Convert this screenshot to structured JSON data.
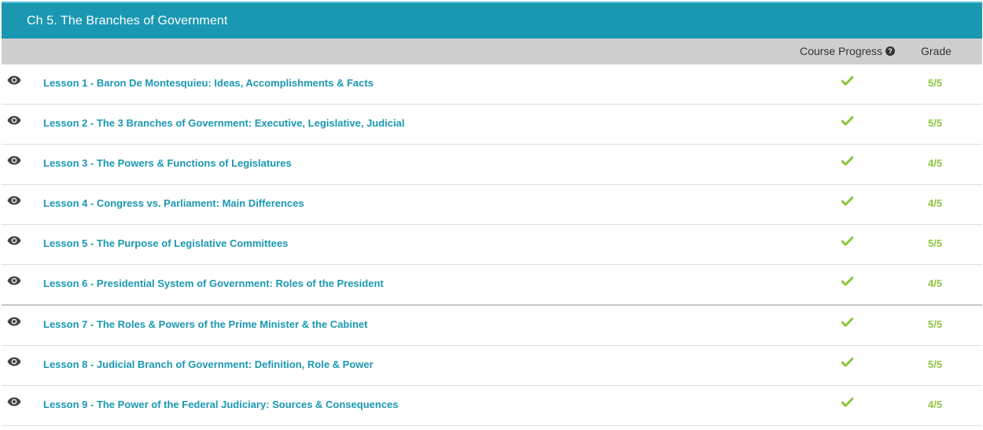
{
  "chapter": {
    "title": "Ch 5. The Branches of Government"
  },
  "columns": {
    "progress_label": "Course Progress",
    "help_glyph": "?",
    "grade_label": "Grade"
  },
  "colors": {
    "header_bg": "#1a98b2",
    "link": "#1a98b2",
    "check": "#8dc63f",
    "grade": "#8dc63f"
  },
  "icons": {
    "view": "eye-icon",
    "progress": "check-icon",
    "help": "question-circle-icon"
  },
  "lessons": [
    {
      "title": "Lesson 1 - Baron De Montesquieu: Ideas, Accomplishments & Facts",
      "completed": true,
      "grade": "5/5"
    },
    {
      "title": "Lesson 2 - The 3 Branches of Government: Executive, Legislative, Judicial",
      "completed": true,
      "grade": "5/5"
    },
    {
      "title": "Lesson 3 - The Powers & Functions of Legislatures",
      "completed": true,
      "grade": "4/5"
    },
    {
      "title": "Lesson 4 - Congress vs. Parliament: Main Differences",
      "completed": true,
      "grade": "4/5"
    },
    {
      "title": "Lesson 5 - The Purpose of Legislative Committees",
      "completed": true,
      "grade": "5/5"
    },
    {
      "title": "Lesson 6 - Presidential System of Government: Roles of the President",
      "completed": true,
      "grade": "4/5"
    },
    {
      "title": "Lesson 7 - The Roles & Powers of the Prime Minister & the Cabinet",
      "completed": true,
      "grade": "5/5"
    },
    {
      "title": "Lesson 8 - Judicial Branch of Government: Definition, Role & Power",
      "completed": true,
      "grade": "5/5"
    },
    {
      "title": "Lesson 9 - The Power of the Federal Judiciary: Sources & Consequences",
      "completed": true,
      "grade": "4/5"
    }
  ]
}
